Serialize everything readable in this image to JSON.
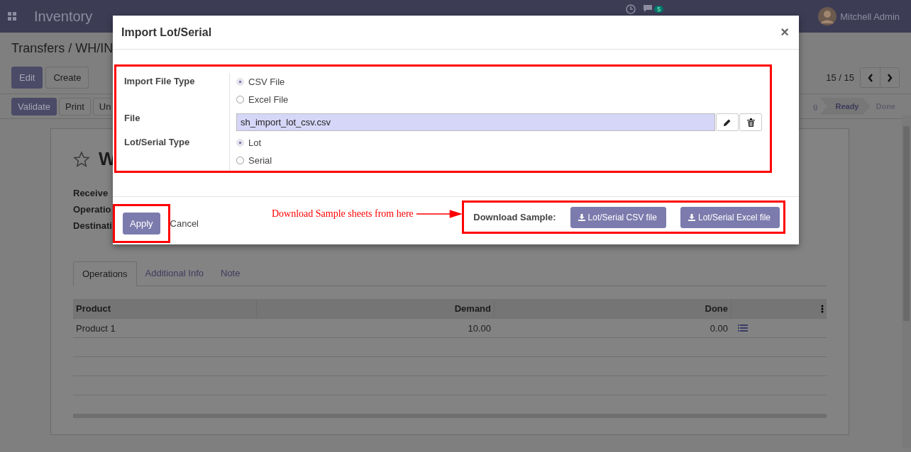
{
  "navbar": {
    "app_name": "Inventory",
    "messages_badge": "5",
    "user": "Mitchell Admin"
  },
  "breadcrumb": "Transfers / WH/IN",
  "buttons": [
    {
      "label": "Edit",
      "kind": "primary"
    },
    {
      "label": "Create",
      "kind": "secondary"
    }
  ],
  "pager": "15 / 15",
  "actions": [
    {
      "label": "Validate",
      "kind": "primary"
    },
    {
      "label": "Print",
      "kind": "secondary"
    },
    {
      "label": "Un",
      "kind": "secondary"
    }
  ],
  "status_steps": [
    {
      "label": "g",
      "selected": false
    },
    {
      "label": "Ready",
      "selected": true
    },
    {
      "label": "Done",
      "selected": false
    }
  ],
  "record": {
    "title": "W",
    "fields": [
      "Receive",
      "Operatio",
      "Destinati"
    ]
  },
  "tabs": [
    {
      "label": "Operations",
      "selected": true
    },
    {
      "label": "Additional Info",
      "selected": false
    },
    {
      "label": "Note",
      "selected": false
    }
  ],
  "table": {
    "columns": [
      "Product",
      "Demand",
      "Done"
    ],
    "rows": [
      [
        "Product 1",
        "10.00",
        "0.00"
      ]
    ]
  },
  "dialog": {
    "title": "Import Lot/Serial",
    "close": "×",
    "fields": [
      {
        "label": "Import File Type",
        "kind": "radio",
        "options": [
          {
            "label": "CSV File",
            "selected": true
          },
          {
            "label": "Excel File",
            "selected": false
          }
        ]
      },
      {
        "label": "File",
        "kind": "file",
        "value": "sh_import_lot_csv.csv"
      },
      {
        "label": "Lot/Serial Type",
        "kind": "radio",
        "options": [
          {
            "label": "Lot",
            "selected": true
          },
          {
            "label": "Serial",
            "selected": false
          }
        ]
      }
    ],
    "apply": "Apply",
    "cancel": "Cancel",
    "download_label": "Download Sample:",
    "download_buttons": [
      "Lot/Serial CSV file",
      "Lot/Serial Excel file"
    ]
  },
  "annotation": {
    "text": "Download Sample sheets from here"
  }
}
